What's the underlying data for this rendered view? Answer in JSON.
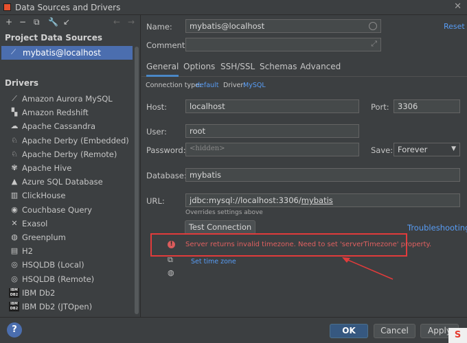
{
  "window": {
    "title": "Data Sources and Drivers",
    "close_symbol": "✕"
  },
  "toolbar": {
    "add": "+",
    "remove": "−",
    "duplicate": "⧉",
    "settings": "🔧",
    "move": "↙",
    "back": "←",
    "forward": "→"
  },
  "left": {
    "project_header": "Project Data Sources",
    "selected_source": "mybatis@localhost",
    "drivers_header": "Drivers",
    "drivers": [
      {
        "label": "Amazon Aurora MySQL",
        "icon": "aurora-icon",
        "glyph": "⟋"
      },
      {
        "label": "Amazon Redshift",
        "icon": "redshift-icon",
        "glyph": "▚"
      },
      {
        "label": "Apache Cassandra",
        "icon": "cassandra-icon",
        "glyph": "☁"
      },
      {
        "label": "Apache Derby (Embedded)",
        "icon": "derby-icon",
        "glyph": "♘"
      },
      {
        "label": "Apache Derby (Remote)",
        "icon": "derby-icon",
        "glyph": "♘"
      },
      {
        "label": "Apache Hive",
        "icon": "hive-icon",
        "glyph": "✾"
      },
      {
        "label": "Azure SQL Database",
        "icon": "azure-icon",
        "glyph": "▲"
      },
      {
        "label": "ClickHouse",
        "icon": "clickhouse-icon",
        "glyph": "▥"
      },
      {
        "label": "Couchbase Query",
        "icon": "couchbase-icon",
        "glyph": "◉"
      },
      {
        "label": "Exasol",
        "icon": "exasol-icon",
        "glyph": "✕"
      },
      {
        "label": "Greenplum",
        "icon": "greenplum-icon",
        "glyph": "◍"
      },
      {
        "label": "H2",
        "icon": "h2-icon",
        "glyph": "▤"
      },
      {
        "label": "HSQLDB (Local)",
        "icon": "hsqldb-icon",
        "glyph": "◎"
      },
      {
        "label": "HSQLDB (Remote)",
        "icon": "hsqldb-icon",
        "glyph": "◎"
      },
      {
        "label": "IBM Db2",
        "icon": "ibm-db2-icon",
        "glyph": "IBM DB2"
      },
      {
        "label": "IBM Db2 (JTOpen)",
        "icon": "ibm-db2-icon",
        "glyph": "IBM DB2"
      }
    ]
  },
  "form": {
    "name_label": "Name:",
    "name_value": "mybatis@localhost",
    "reset": "Reset",
    "comment_label": "Comment:",
    "comment_value": "",
    "tabs": [
      "General",
      "Options",
      "SSH/SSL",
      "Schemas",
      "Advanced"
    ],
    "conn_type_label": "Connection type:",
    "conn_type_value": "default",
    "driver_label": "Driver:",
    "driver_value": "MySQL",
    "host_label": "Host:",
    "host_value": "localhost",
    "port_label": "Port:",
    "port_value": "3306",
    "user_label": "User:",
    "user_value": "root",
    "password_label": "Password:",
    "password_placeholder": "<hidden>",
    "save_label": "Save:",
    "save_value": "Forever",
    "database_label": "Database:",
    "database_value": "mybatis",
    "url_label": "URL:",
    "url_prefix": "jdbc:mysql://localhost:3306/",
    "url_db": "mybatis",
    "url_note": "Overrides settings above",
    "test_connection": "Test Connection",
    "troubleshooting": "Troubleshooting",
    "error_message": "Server returns invalid timezone. Need to set 'serverTimezone' property.",
    "set_time_zone": "Set time zone"
  },
  "buttons": {
    "help": "?",
    "ok": "OK",
    "cancel": "Cancel",
    "apply": "Apply"
  },
  "colors": {
    "accent": "#4b6eaf",
    "link": "#589df6",
    "error": "#e06060",
    "error_box": "#e23b3b"
  }
}
